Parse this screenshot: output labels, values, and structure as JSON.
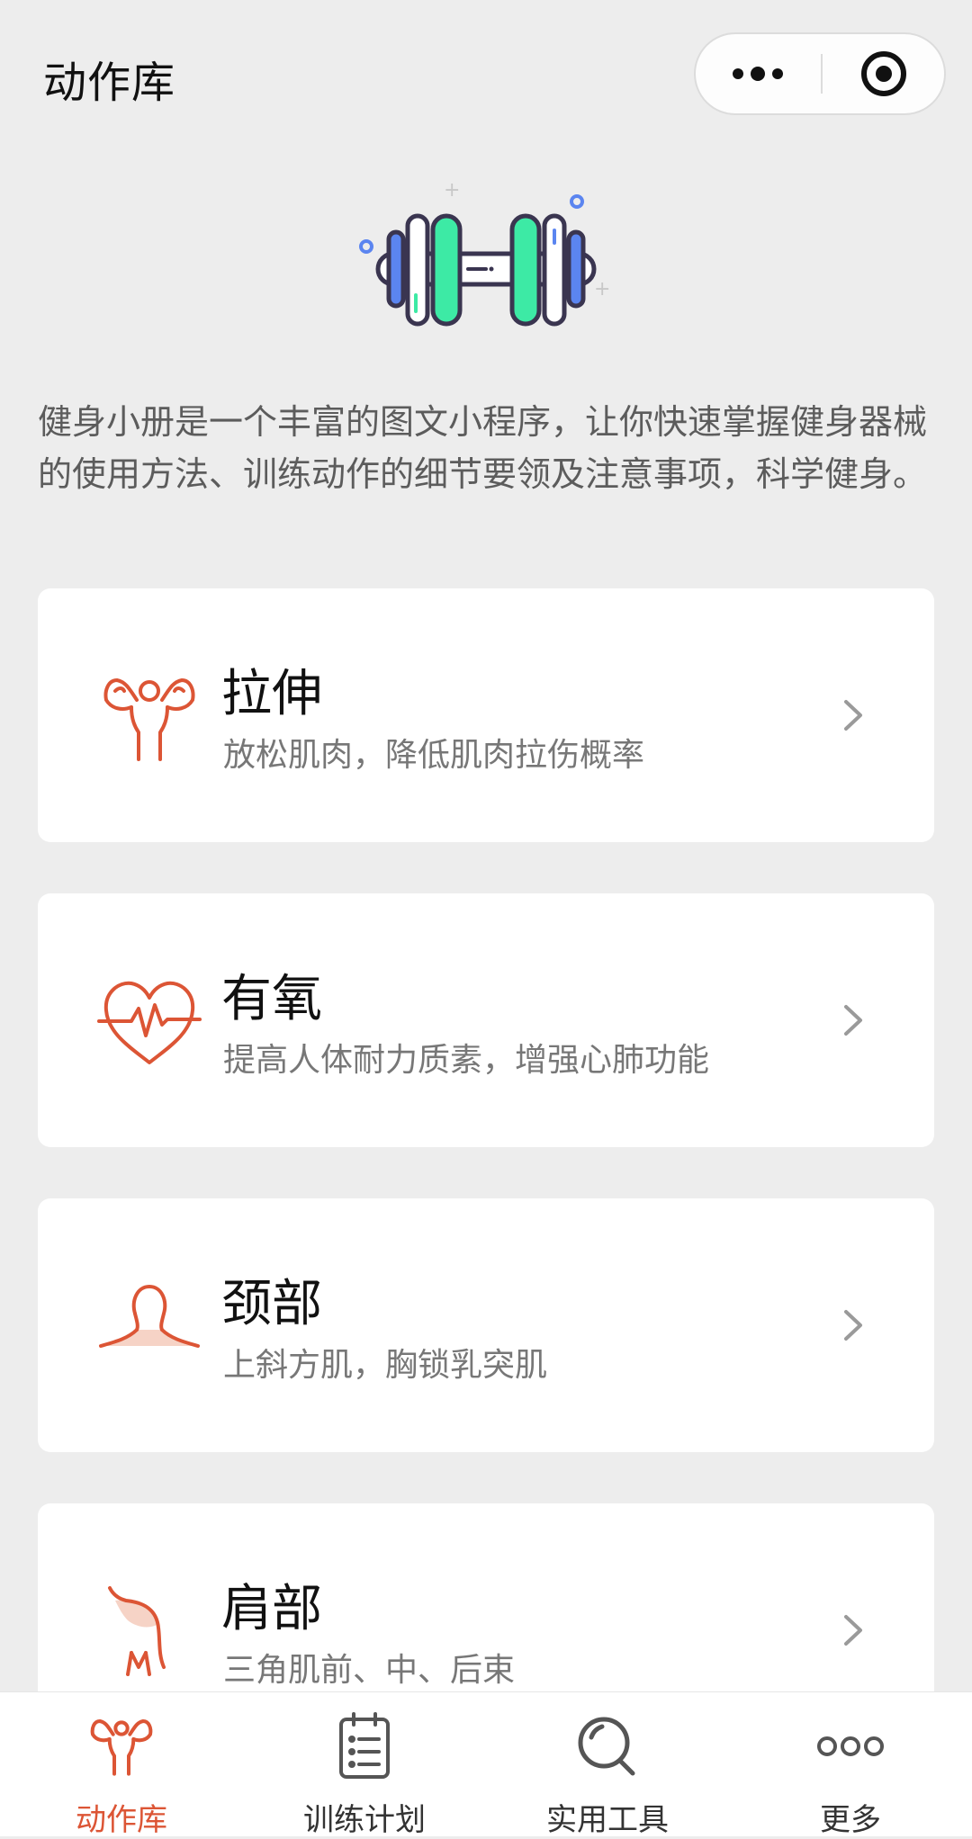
{
  "nav": {
    "title": "动作库",
    "more_icon": "more-dots-icon",
    "close_icon": "close-target-icon"
  },
  "hero": {
    "icon": "dumbbell-icon"
  },
  "intro": "健身小册是一个丰富的图文小程序，让你快速掌握健身器械的使用方法、训练动作的细节要领及注意事项，科学健身。",
  "categories": [
    {
      "title": "拉伸",
      "subtitle": "放松肌肉，降低肌肉拉伤概率",
      "icon": "flexing-muscle-icon"
    },
    {
      "title": "有氧",
      "subtitle": "提高人体耐力质素，增强心肺功能",
      "icon": "heartbeat-icon"
    },
    {
      "title": "颈部",
      "subtitle": "上斜方肌，胸锁乳突肌",
      "icon": "neck-icon"
    },
    {
      "title": "肩部",
      "subtitle": "三角肌前、中、后束",
      "icon": "shoulder-icon"
    }
  ],
  "tabbar": [
    {
      "label": "动作库",
      "icon": "flexing-muscle-icon",
      "active": true
    },
    {
      "label": "训练计划",
      "icon": "clipboard-list-icon",
      "active": false
    },
    {
      "label": "实用工具",
      "icon": "search-icon",
      "active": false
    },
    {
      "label": "更多",
      "icon": "more-circles-icon",
      "active": false
    }
  ],
  "colors": {
    "accent": "#dc5535",
    "background": "#ededed",
    "card": "#ffffff",
    "dumbbell_green": "#3deaa5",
    "dumbbell_blue": "#5b85f0"
  }
}
